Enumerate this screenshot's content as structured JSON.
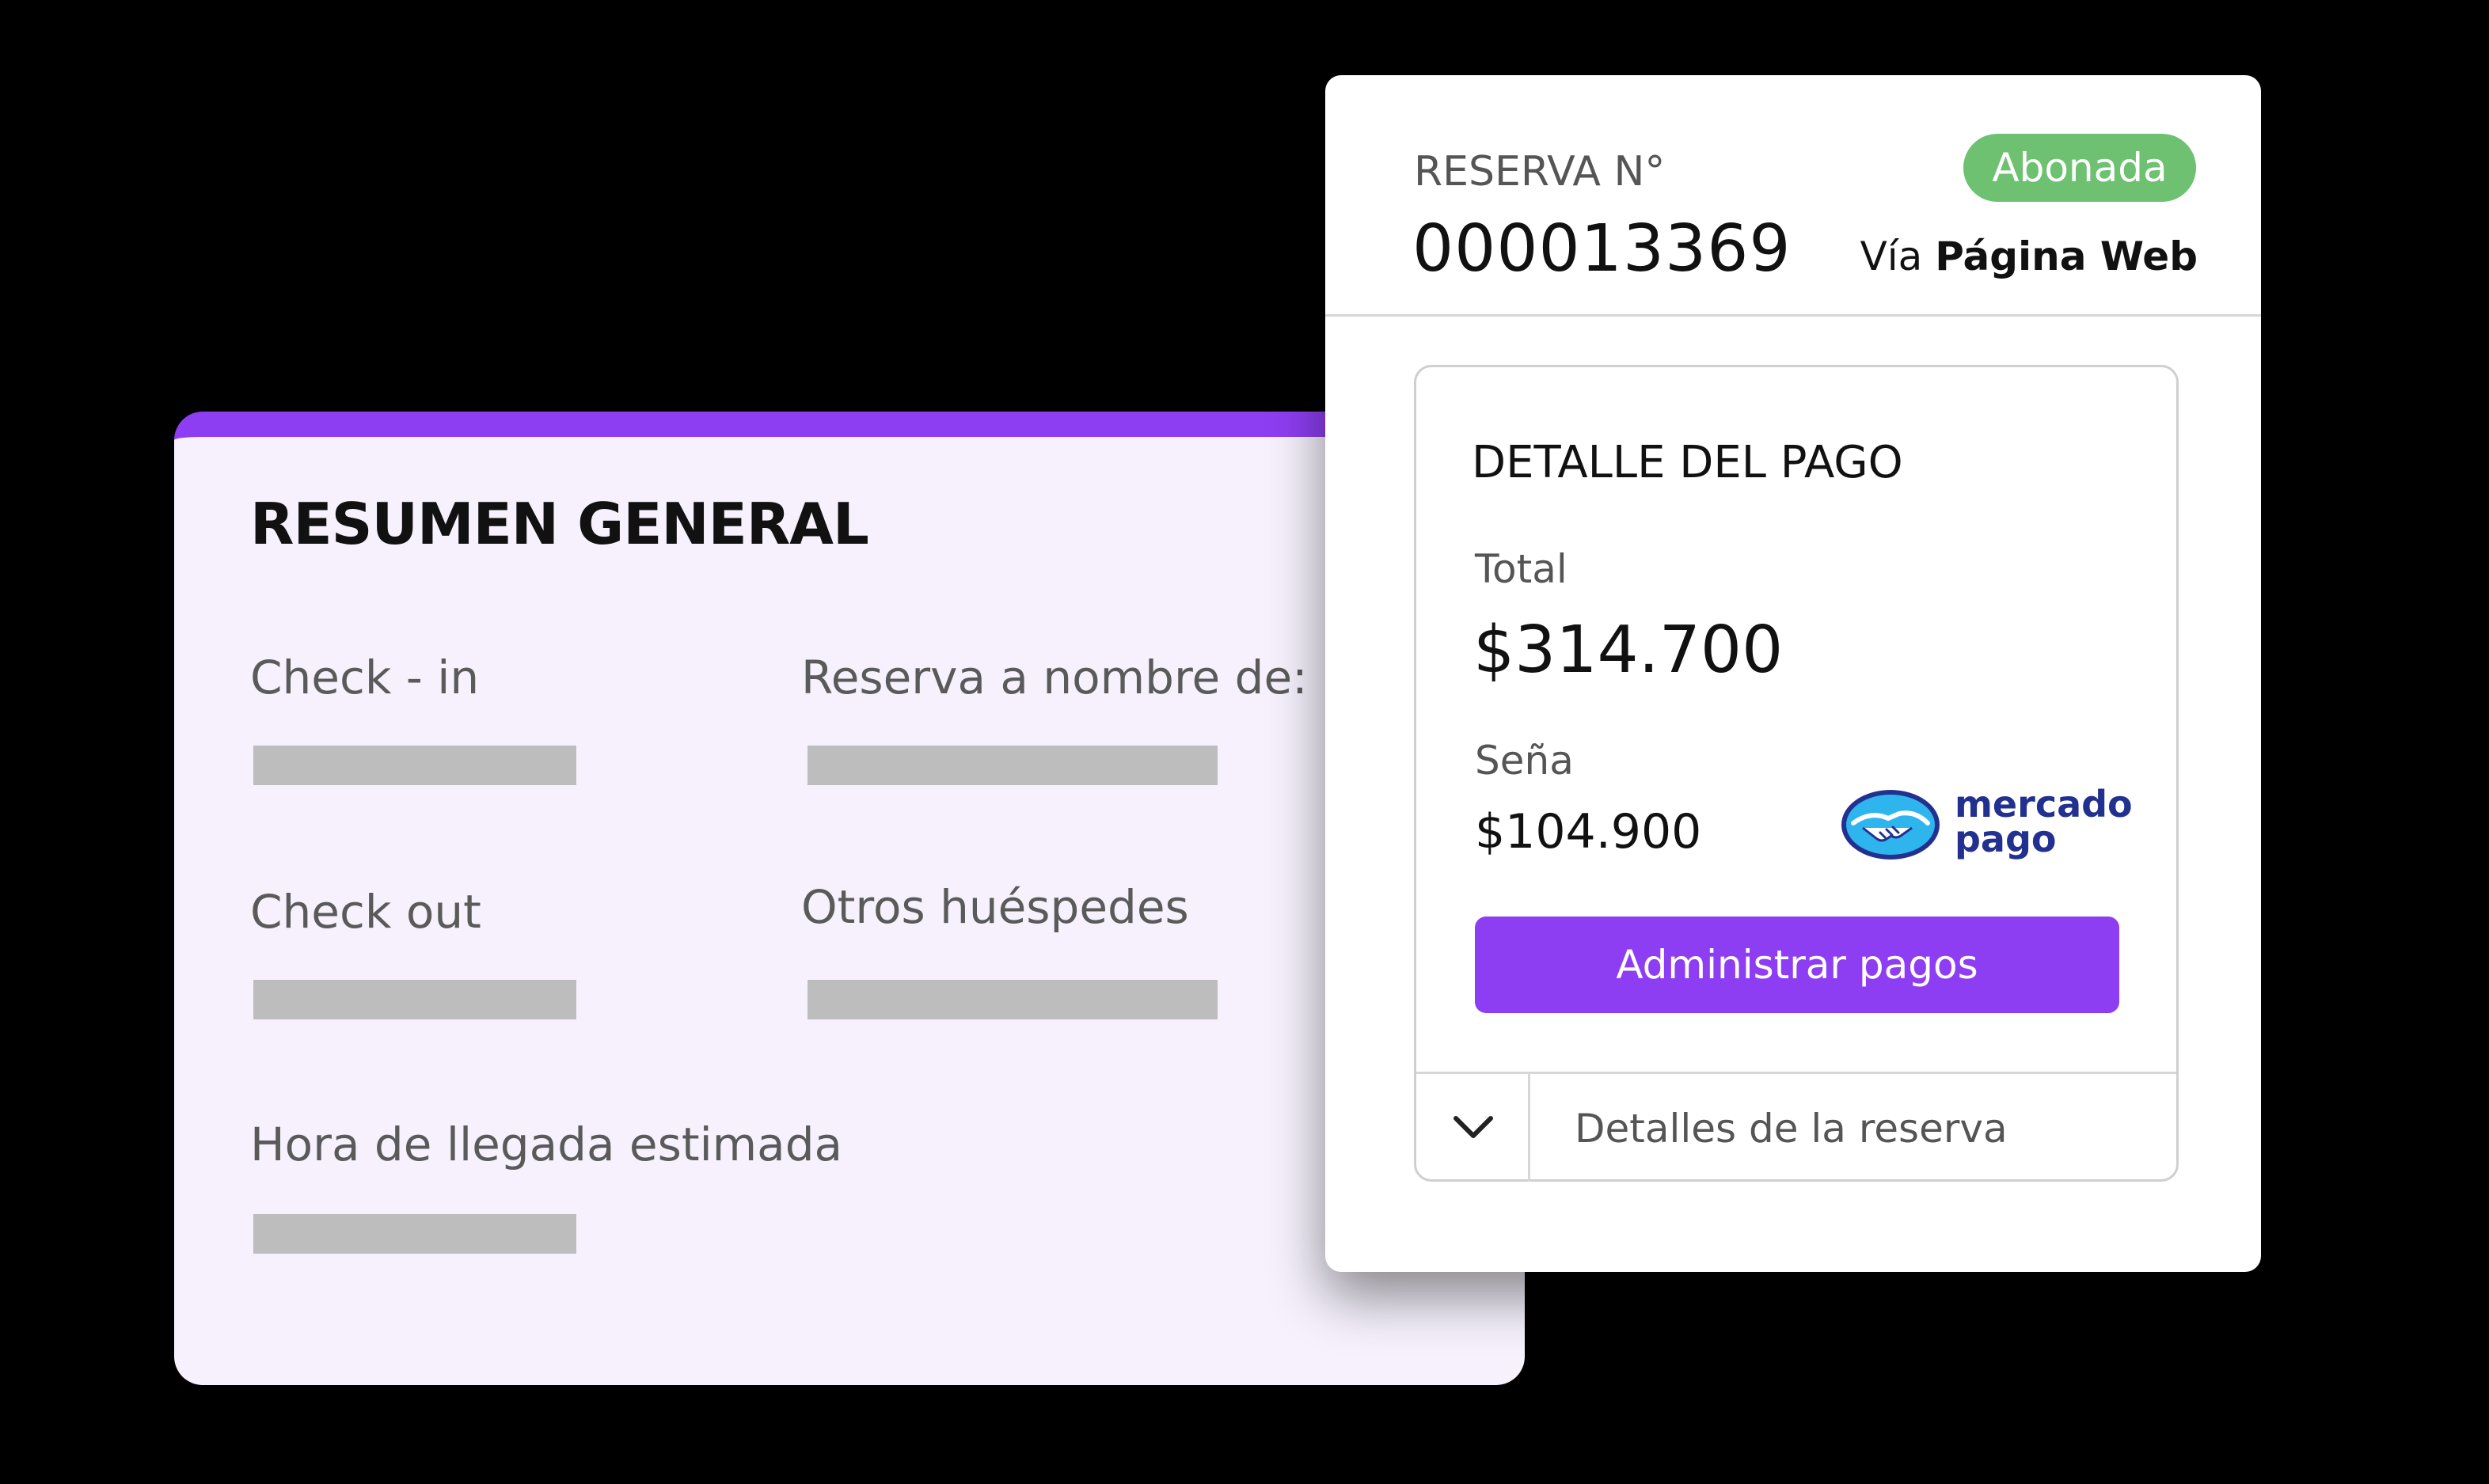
{
  "summary": {
    "title": "RESUMEN GENERAL",
    "fields": {
      "check_in": "Check - in",
      "reserva_nombre": "Reserva a nombre de:",
      "check_out": "Check  out",
      "otros_huespedes": "Otros huéspedes",
      "hora_llegada": "Hora de llegada estimada"
    }
  },
  "reserva": {
    "label": "RESERVA N°",
    "number": "000013369",
    "status": "Abonada",
    "via_prefix": "Vía ",
    "via_source": "Página Web"
  },
  "payment": {
    "title": "DETALLE DEL PAGO",
    "total_label": "Total",
    "total_value": "$314.700",
    "sena_label": "Seña",
    "sena_value": "$104.900",
    "provider_line1": "mercado",
    "provider_line2": "pago",
    "manage_button": "Administrar pagos",
    "details_toggle": "Detalles de la reserva"
  },
  "colors": {
    "accent": "#8e3ef2",
    "status_green": "#6dc170",
    "summary_bg": "#f6f1fd",
    "mercadopago_blue": "#22318f",
    "mercadopago_light": "#2fb5ee"
  },
  "icons": {
    "chevron": "chevron-down-icon",
    "payment_provider": "mercado-pago-handshake-icon"
  }
}
